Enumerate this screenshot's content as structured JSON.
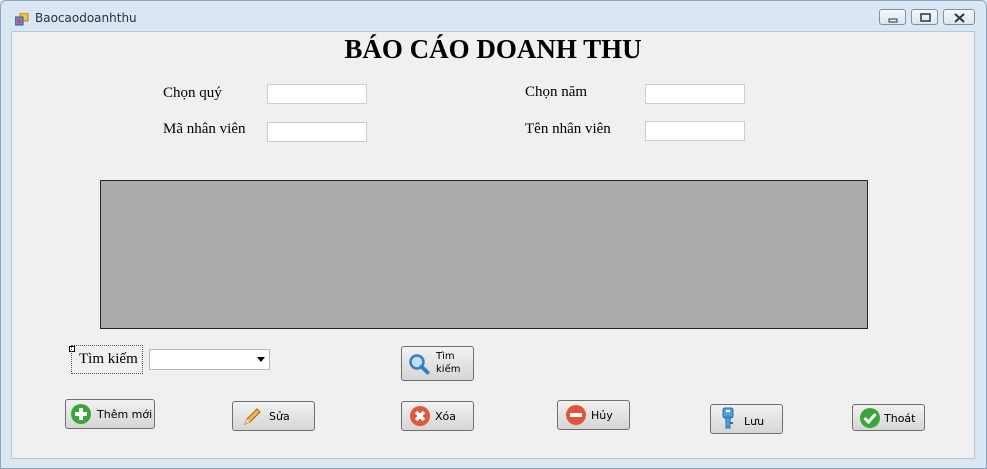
{
  "window": {
    "title": "Baocaodoanhthu"
  },
  "form": {
    "heading": "BÁO CÁO DOANH THU",
    "quarter_label": "Chọn quý",
    "year_label": "Chọn năm",
    "employee_id_label": "Mã nhân viên",
    "employee_name_label": "Tên nhân viên",
    "quarter_value": "",
    "year_value": "",
    "employee_id_value": "",
    "employee_name_value": ""
  },
  "search": {
    "label": "Tìm kiếm",
    "combo_value": "",
    "button_line1": "Tìm",
    "button_line2": "kiếm"
  },
  "actions": {
    "add": "Thêm mới",
    "edit": "Sửa",
    "delete": "Xóa",
    "cancel": "Hủy",
    "save": "Lưu",
    "exit": "Thoát"
  },
  "colors": {
    "grid_bg": "#ababab",
    "add_icon": "#3aa53a",
    "delete_icon": "#e0573b",
    "cancel_icon": "#e0573b",
    "save_icon": "#4f9fdc",
    "exit_icon": "#3aa53a",
    "search_icon": "#2f7fc9"
  }
}
